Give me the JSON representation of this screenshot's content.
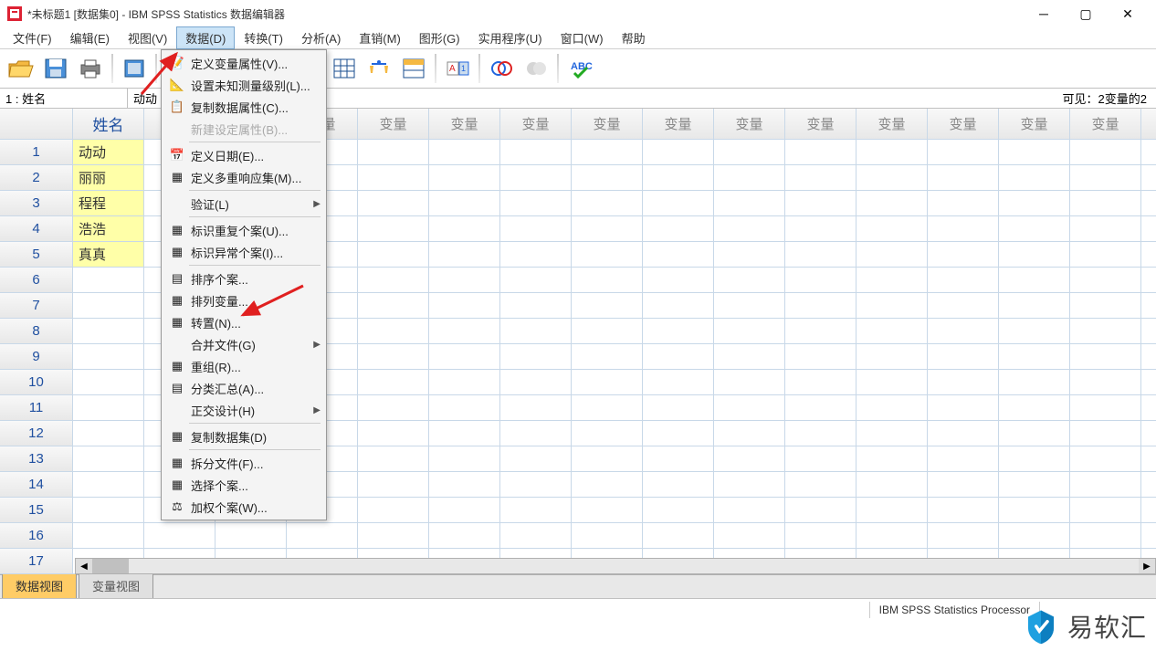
{
  "window": {
    "title": "*未标题1 [数据集0] - IBM SPSS Statistics 数据编辑器"
  },
  "menubar": [
    "文件(F)",
    "编辑(E)",
    "视图(V)",
    "数据(D)",
    "转换(T)",
    "分析(A)",
    "直销(M)",
    "图形(G)",
    "实用程序(U)",
    "窗口(W)",
    "帮助"
  ],
  "active_menu_index": 3,
  "infobar": {
    "ref": "1 : 姓名",
    "val": "动动",
    "visible": "可见：2变量的2"
  },
  "columns": [
    "姓名",
    "变量",
    "变量",
    "变量",
    "变量",
    "变量",
    "变量",
    "变量",
    "变量",
    "变量",
    "变量",
    "变量",
    "变量",
    "变量",
    "变量",
    "变量"
  ],
  "rows": [
    {
      "n": "1",
      "v": "动动"
    },
    {
      "n": "2",
      "v": "丽丽"
    },
    {
      "n": "3",
      "v": "程程"
    },
    {
      "n": "4",
      "v": "浩浩"
    },
    {
      "n": "5",
      "v": "真真"
    },
    {
      "n": "6",
      "v": ""
    },
    {
      "n": "7",
      "v": ""
    },
    {
      "n": "8",
      "v": ""
    },
    {
      "n": "9",
      "v": ""
    },
    {
      "n": "10",
      "v": ""
    },
    {
      "n": "11",
      "v": ""
    },
    {
      "n": "12",
      "v": ""
    },
    {
      "n": "13",
      "v": ""
    },
    {
      "n": "14",
      "v": ""
    },
    {
      "n": "15",
      "v": ""
    },
    {
      "n": "16",
      "v": ""
    },
    {
      "n": "17",
      "v": ""
    }
  ],
  "dropdown": [
    {
      "icon": "📝",
      "label": "定义变量属性(V)..."
    },
    {
      "icon": "📐",
      "label": "设置未知测量级别(L)..."
    },
    {
      "icon": "📋",
      "label": "复制数据属性(C)..."
    },
    {
      "icon": "",
      "label": "新建设定属性(B)...",
      "disabled": true
    },
    {
      "sep": true
    },
    {
      "icon": "📅",
      "label": "定义日期(E)..."
    },
    {
      "icon": "▦",
      "label": "定义多重响应集(M)..."
    },
    {
      "sep": true
    },
    {
      "icon": "",
      "label": "验证(L)",
      "submenu": true
    },
    {
      "sep": true
    },
    {
      "icon": "▦",
      "label": "标识重复个案(U)..."
    },
    {
      "icon": "▦",
      "label": "标识异常个案(I)..."
    },
    {
      "sep": true
    },
    {
      "icon": "▤",
      "label": "排序个案..."
    },
    {
      "icon": "▦",
      "label": "排列变量..."
    },
    {
      "icon": "▦",
      "label": "转置(N)..."
    },
    {
      "icon": "",
      "label": "合并文件(G)",
      "submenu": true
    },
    {
      "icon": "▦",
      "label": "重组(R)..."
    },
    {
      "icon": "▤",
      "label": "分类汇总(A)..."
    },
    {
      "icon": "",
      "label": "正交设计(H)",
      "submenu": true
    },
    {
      "sep": true
    },
    {
      "icon": "▦",
      "label": "复制数据集(D)"
    },
    {
      "sep": true
    },
    {
      "icon": "▦",
      "label": "拆分文件(F)..."
    },
    {
      "icon": "▦",
      "label": "选择个案..."
    },
    {
      "icon": "⚖",
      "label": "加权个案(W)..."
    }
  ],
  "tabs": {
    "data": "数据视图",
    "var": "变量视图"
  },
  "statusbar": {
    "processor": "IBM SPSS Statistics Processor"
  },
  "watermark": "易软汇"
}
